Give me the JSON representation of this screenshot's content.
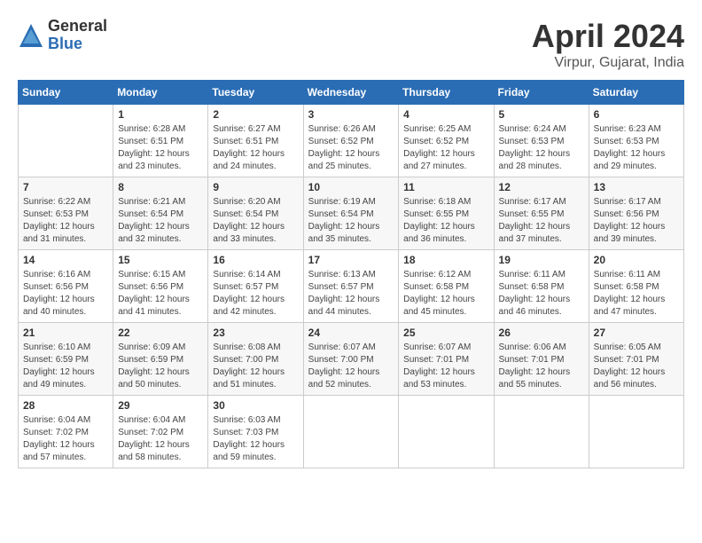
{
  "logo": {
    "general": "General",
    "blue": "Blue"
  },
  "title": "April 2024",
  "location": "Virpur, Gujarat, India",
  "days_of_week": [
    "Sunday",
    "Monday",
    "Tuesday",
    "Wednesday",
    "Thursday",
    "Friday",
    "Saturday"
  ],
  "weeks": [
    [
      {
        "day": "",
        "info": ""
      },
      {
        "day": "1",
        "info": "Sunrise: 6:28 AM\nSunset: 6:51 PM\nDaylight: 12 hours\nand 23 minutes."
      },
      {
        "day": "2",
        "info": "Sunrise: 6:27 AM\nSunset: 6:51 PM\nDaylight: 12 hours\nand 24 minutes."
      },
      {
        "day": "3",
        "info": "Sunrise: 6:26 AM\nSunset: 6:52 PM\nDaylight: 12 hours\nand 25 minutes."
      },
      {
        "day": "4",
        "info": "Sunrise: 6:25 AM\nSunset: 6:52 PM\nDaylight: 12 hours\nand 27 minutes."
      },
      {
        "day": "5",
        "info": "Sunrise: 6:24 AM\nSunset: 6:53 PM\nDaylight: 12 hours\nand 28 minutes."
      },
      {
        "day": "6",
        "info": "Sunrise: 6:23 AM\nSunset: 6:53 PM\nDaylight: 12 hours\nand 29 minutes."
      }
    ],
    [
      {
        "day": "7",
        "info": "Sunrise: 6:22 AM\nSunset: 6:53 PM\nDaylight: 12 hours\nand 31 minutes."
      },
      {
        "day": "8",
        "info": "Sunrise: 6:21 AM\nSunset: 6:54 PM\nDaylight: 12 hours\nand 32 minutes."
      },
      {
        "day": "9",
        "info": "Sunrise: 6:20 AM\nSunset: 6:54 PM\nDaylight: 12 hours\nand 33 minutes."
      },
      {
        "day": "10",
        "info": "Sunrise: 6:19 AM\nSunset: 6:54 PM\nDaylight: 12 hours\nand 35 minutes."
      },
      {
        "day": "11",
        "info": "Sunrise: 6:18 AM\nSunset: 6:55 PM\nDaylight: 12 hours\nand 36 minutes."
      },
      {
        "day": "12",
        "info": "Sunrise: 6:17 AM\nSunset: 6:55 PM\nDaylight: 12 hours\nand 37 minutes."
      },
      {
        "day": "13",
        "info": "Sunrise: 6:17 AM\nSunset: 6:56 PM\nDaylight: 12 hours\nand 39 minutes."
      }
    ],
    [
      {
        "day": "14",
        "info": "Sunrise: 6:16 AM\nSunset: 6:56 PM\nDaylight: 12 hours\nand 40 minutes."
      },
      {
        "day": "15",
        "info": "Sunrise: 6:15 AM\nSunset: 6:56 PM\nDaylight: 12 hours\nand 41 minutes."
      },
      {
        "day": "16",
        "info": "Sunrise: 6:14 AM\nSunset: 6:57 PM\nDaylight: 12 hours\nand 42 minutes."
      },
      {
        "day": "17",
        "info": "Sunrise: 6:13 AM\nSunset: 6:57 PM\nDaylight: 12 hours\nand 44 minutes."
      },
      {
        "day": "18",
        "info": "Sunrise: 6:12 AM\nSunset: 6:58 PM\nDaylight: 12 hours\nand 45 minutes."
      },
      {
        "day": "19",
        "info": "Sunrise: 6:11 AM\nSunset: 6:58 PM\nDaylight: 12 hours\nand 46 minutes."
      },
      {
        "day": "20",
        "info": "Sunrise: 6:11 AM\nSunset: 6:58 PM\nDaylight: 12 hours\nand 47 minutes."
      }
    ],
    [
      {
        "day": "21",
        "info": "Sunrise: 6:10 AM\nSunset: 6:59 PM\nDaylight: 12 hours\nand 49 minutes."
      },
      {
        "day": "22",
        "info": "Sunrise: 6:09 AM\nSunset: 6:59 PM\nDaylight: 12 hours\nand 50 minutes."
      },
      {
        "day": "23",
        "info": "Sunrise: 6:08 AM\nSunset: 7:00 PM\nDaylight: 12 hours\nand 51 minutes."
      },
      {
        "day": "24",
        "info": "Sunrise: 6:07 AM\nSunset: 7:00 PM\nDaylight: 12 hours\nand 52 minutes."
      },
      {
        "day": "25",
        "info": "Sunrise: 6:07 AM\nSunset: 7:01 PM\nDaylight: 12 hours\nand 53 minutes."
      },
      {
        "day": "26",
        "info": "Sunrise: 6:06 AM\nSunset: 7:01 PM\nDaylight: 12 hours\nand 55 minutes."
      },
      {
        "day": "27",
        "info": "Sunrise: 6:05 AM\nSunset: 7:01 PM\nDaylight: 12 hours\nand 56 minutes."
      }
    ],
    [
      {
        "day": "28",
        "info": "Sunrise: 6:04 AM\nSunset: 7:02 PM\nDaylight: 12 hours\nand 57 minutes."
      },
      {
        "day": "29",
        "info": "Sunrise: 6:04 AM\nSunset: 7:02 PM\nDaylight: 12 hours\nand 58 minutes."
      },
      {
        "day": "30",
        "info": "Sunrise: 6:03 AM\nSunset: 7:03 PM\nDaylight: 12 hours\nand 59 minutes."
      },
      {
        "day": "",
        "info": ""
      },
      {
        "day": "",
        "info": ""
      },
      {
        "day": "",
        "info": ""
      },
      {
        "day": "",
        "info": ""
      }
    ]
  ]
}
